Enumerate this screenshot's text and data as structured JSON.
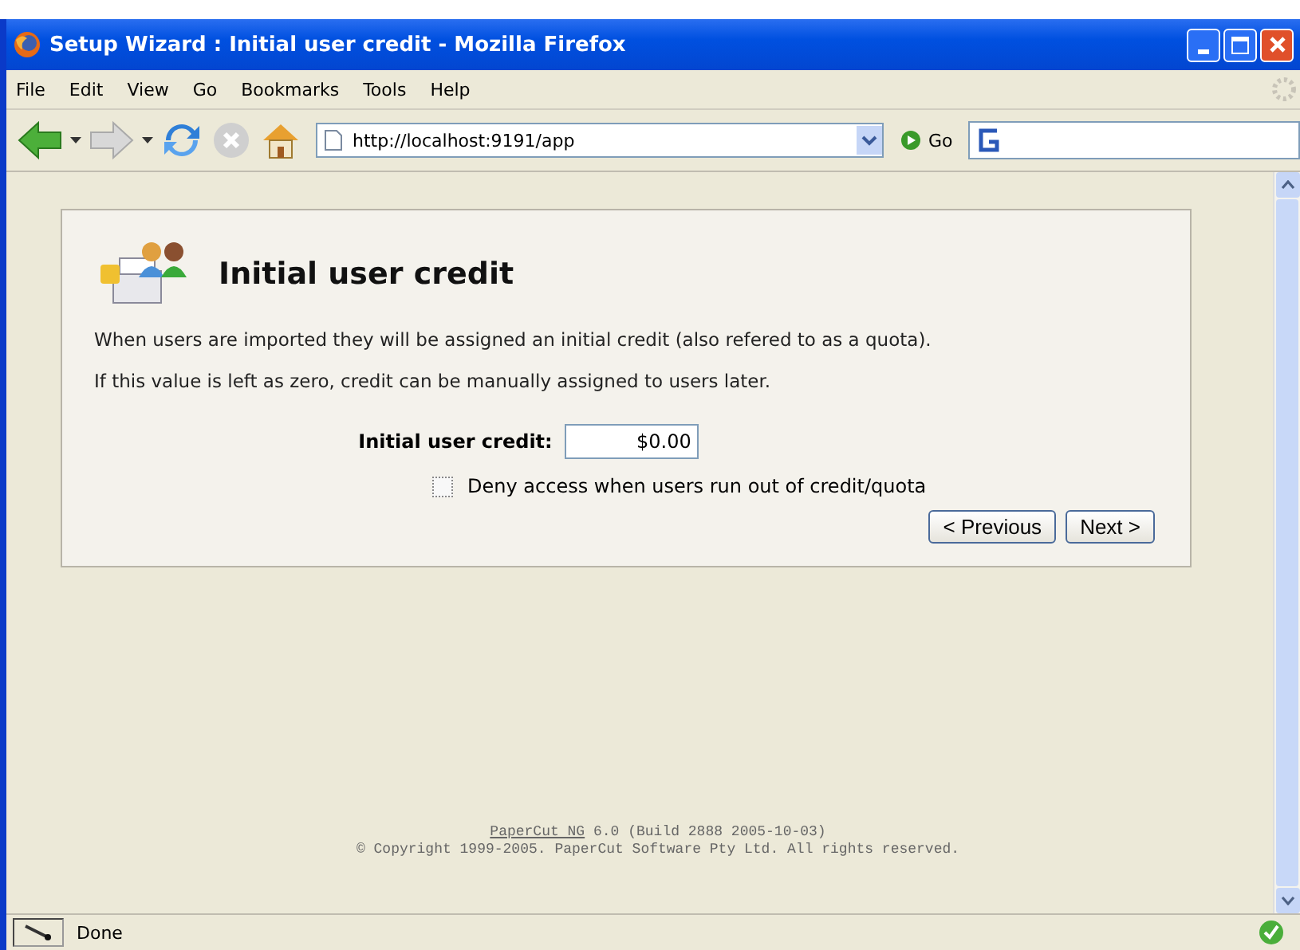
{
  "window": {
    "title": "Setup Wizard : Initial user credit - Mozilla Firefox"
  },
  "menu": [
    "File",
    "Edit",
    "View",
    "Go",
    "Bookmarks",
    "Tools",
    "Help"
  ],
  "toolbar": {
    "url": "http://localhost:9191/app",
    "go": "Go"
  },
  "page": {
    "heading": "Initial user credit",
    "paragraphs": [
      "When users are imported they will be assigned an initial credit (also refered to as a quota).",
      "If this value is left as zero, credit can be manually assigned to users later."
    ],
    "credit_label": "Initial user credit:",
    "credit_value": "$0.00",
    "deny_checkbox": {
      "label": "Deny access when users run out of credit/quota",
      "checked": false
    },
    "buttons": [
      "< Previous",
      "Next >"
    ]
  },
  "footer": {
    "product_link": "PaperCut NG",
    "build": "6.0 (Build 2888 2005-10-03)",
    "copyright": "© Copyright 1999-2005. PaperCut Software Pty Ltd. All rights reserved."
  },
  "status_bar": {
    "text": "Done"
  }
}
